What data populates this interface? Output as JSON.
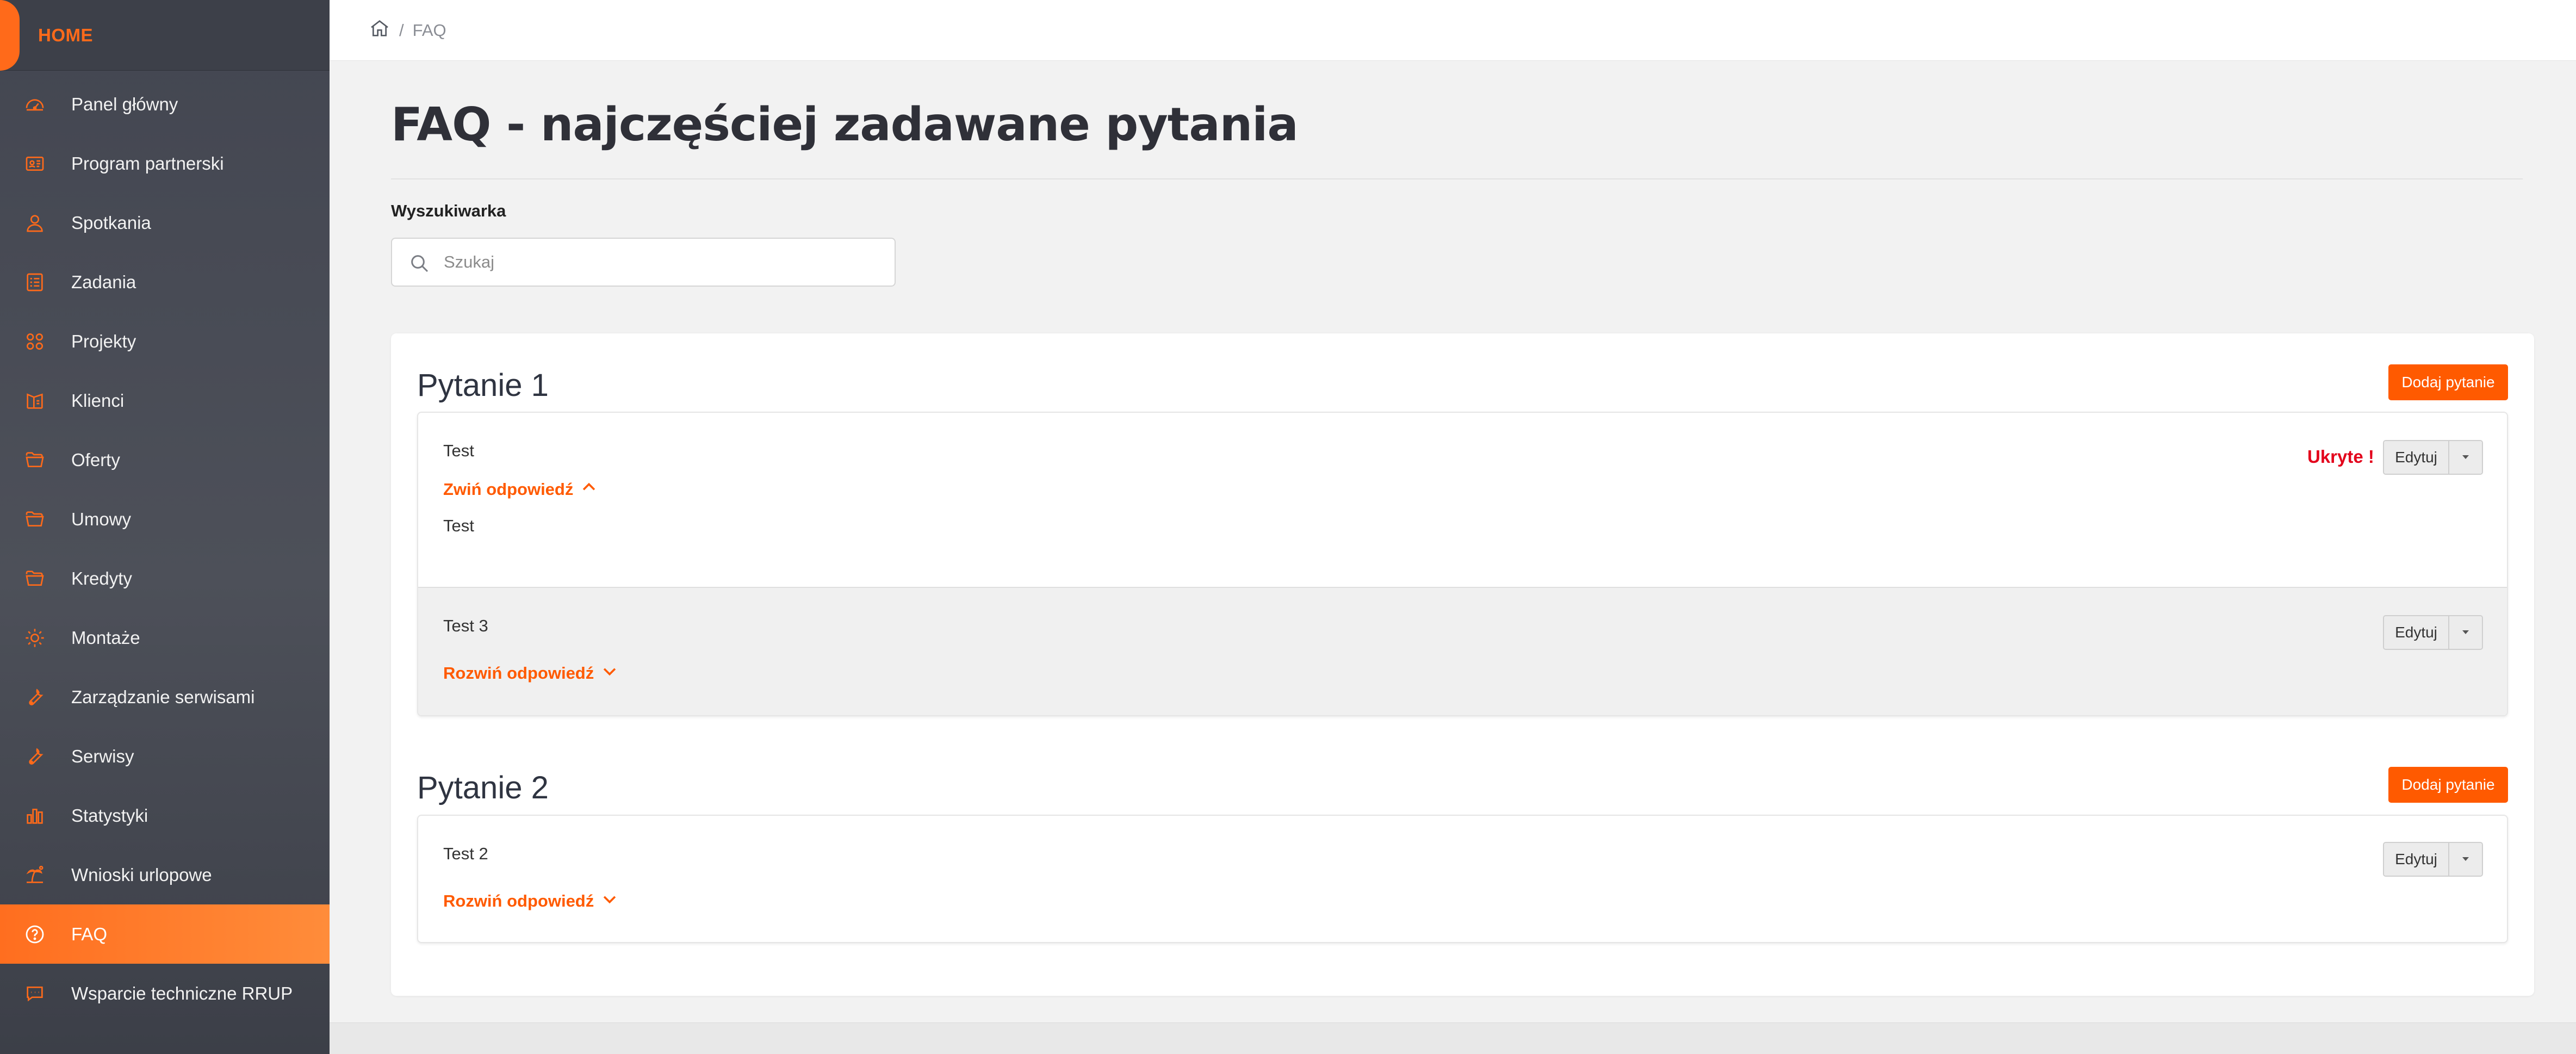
{
  "sidebar": {
    "home_label": "HOME",
    "items": [
      {
        "label": "Panel główny",
        "icon": "dashboard-icon"
      },
      {
        "label": "Program partnerski",
        "icon": "partner-program-icon"
      },
      {
        "label": "Spotkania",
        "icon": "meetings-icon"
      },
      {
        "label": "Zadania",
        "icon": "tasks-icon"
      },
      {
        "label": "Projekty",
        "icon": "projects-icon"
      },
      {
        "label": "Klienci",
        "icon": "clients-icon"
      },
      {
        "label": "Oferty",
        "icon": "folder-icon"
      },
      {
        "label": "Umowy",
        "icon": "folder-icon"
      },
      {
        "label": "Kredyty",
        "icon": "folder-icon"
      },
      {
        "label": "Montaże",
        "icon": "sun-icon"
      },
      {
        "label": "Zarządzanie serwisami",
        "icon": "wrench-icon"
      },
      {
        "label": "Serwisy",
        "icon": "wrench-icon"
      },
      {
        "label": "Statystyki",
        "icon": "bar-chart-icon"
      },
      {
        "label": "Wnioski urlopowe",
        "icon": "vacation-icon"
      },
      {
        "label": "FAQ",
        "icon": "question-circle-icon",
        "active": true
      },
      {
        "label": "Wsparcie techniczne RRUP",
        "icon": "chat-icon"
      }
    ]
  },
  "breadcrumb": {
    "current": "FAQ",
    "separator": "/"
  },
  "page": {
    "title": "FAQ - najczęściej zadawane pytania",
    "search_label": "Wyszukiwarka",
    "search_placeholder": "Szukaj"
  },
  "sections": [
    {
      "title": "Pytanie 1",
      "add_button": "Dodaj pytanie",
      "questions": [
        {
          "question": "Test",
          "toggle_label": "Zwiń odpowiedź",
          "expanded": true,
          "answer": "Test",
          "badge": "Ukryte !",
          "edit_label": "Edytuj"
        },
        {
          "question": "Test 3",
          "toggle_label": "Rozwiń odpowiedź",
          "expanded": false,
          "edit_label": "Edytuj"
        }
      ]
    },
    {
      "title": "Pytanie 2",
      "add_button": "Dodaj pytanie",
      "questions": [
        {
          "question": "Test 2",
          "toggle_label": "Rozwiń odpowiedź",
          "expanded": false,
          "edit_label": "Edytuj"
        }
      ]
    }
  ],
  "colors": {
    "accent": "#ff5a00",
    "sidebar_bg": "#454852",
    "hidden_badge": "#e3001b",
    "title": "#2f3038"
  }
}
